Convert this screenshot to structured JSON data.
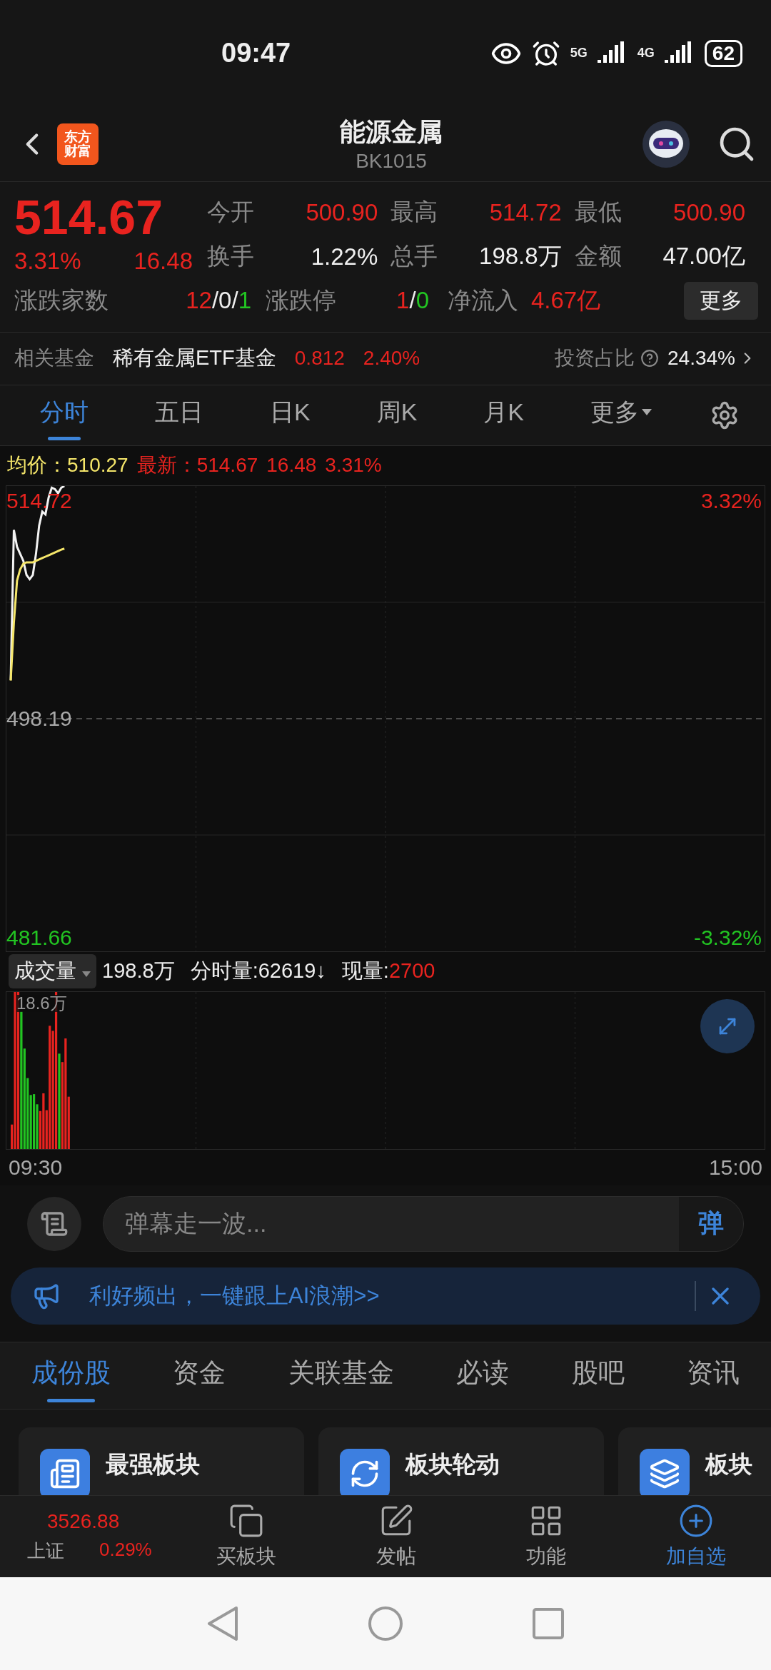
{
  "status_bar": {
    "time": "09:47",
    "net1": "5G",
    "net2": "4G",
    "battery": "62"
  },
  "header": {
    "logo_lines": [
      "东方",
      "财富"
    ],
    "title": "能源金属",
    "code": "BK1015"
  },
  "quote": {
    "price": "514.67",
    "change_pct": "3.31%",
    "change": "16.48",
    "stats": [
      {
        "label": "今开",
        "value": "500.90",
        "color": "#e8231f"
      },
      {
        "label": "最高",
        "value": "514.72",
        "color": "#e8231f"
      },
      {
        "label": "最低",
        "value": "500.90",
        "color": "#e8231f"
      },
      {
        "label": "换手",
        "value": "1.22%",
        "color": "#f0f0f0"
      },
      {
        "label": "总手",
        "value": "198.8万",
        "color": "#f0f0f0"
      },
      {
        "label": "金额",
        "value": "47.00亿",
        "color": "#f0f0f0"
      }
    ],
    "breadth": {
      "label": "涨跌家数",
      "up": "12",
      "sep1": "/",
      "flat": "0",
      "sep2": "/",
      "down": "1"
    },
    "limit": {
      "label": "涨跌停",
      "up": "1",
      "sep": "/",
      "down": "0"
    },
    "inflow": {
      "label": "净流入",
      "value": "4.67亿"
    },
    "more_button": "更多"
  },
  "fund": {
    "label": "相关基金",
    "name": "稀有金属ETF基金",
    "price": "0.812",
    "pct": "2.40%",
    "ratio_label": "投资占比",
    "ratio": "24.34%"
  },
  "chart_tabs": [
    {
      "label": "分时",
      "selected": true
    },
    {
      "label": "五日",
      "selected": false
    },
    {
      "label": "日K",
      "selected": false
    },
    {
      "label": "周K",
      "selected": false
    },
    {
      "label": "月K",
      "selected": false
    },
    {
      "label": "更多",
      "selected": false,
      "kind": "dropdown"
    }
  ],
  "info": {
    "avg_label": "均价：",
    "avg": "510.27",
    "last_label": "最新：",
    "last": "514.67",
    "change": "16.48",
    "pct": "3.31%"
  },
  "price_chart": {
    "kind": "picture",
    "high": "514.72",
    "mid": "498.19",
    "low": "481.66",
    "upper_pct": "3.32%",
    "lower_pct": "-3.32%"
  },
  "volume": {
    "selector": "成交量",
    "total": "198.8万",
    "minute_label": "分时量:",
    "minute": "62619↓",
    "now_label": "现量:",
    "now": "2700",
    "chart": {
      "kind": "picture",
      "scale_label": "18.6万"
    }
  },
  "time_axis": [
    "09:30",
    "15:00"
  ],
  "comment": {
    "placeholder": "弹幕走一波...",
    "send": "弹"
  },
  "banner": {
    "text": "利好频出，一键跟上AI浪潮>>"
  },
  "section_tabs": [
    {
      "label": "成份股",
      "selected": true
    },
    {
      "label": "资金",
      "selected": false
    },
    {
      "label": "关联基金",
      "selected": false
    },
    {
      "label": "必读",
      "selected": false
    },
    {
      "label": "股吧",
      "selected": false
    },
    {
      "label": "资讯",
      "selected": false
    }
  ],
  "cards": [
    {
      "title": "最强板块",
      "kind": "board"
    },
    {
      "title": "板块轮动",
      "kind": "rotate"
    },
    {
      "title": "板块",
      "kind": "layers"
    }
  ],
  "bottom_nav": {
    "index": {
      "value": "3526.88",
      "name": "上证",
      "pct": "0.29%"
    },
    "items": [
      {
        "label": "买板块",
        "kind": "buy",
        "selected": false
      },
      {
        "label": "发帖",
        "kind": "post",
        "selected": false
      },
      {
        "label": "功能",
        "kind": "grid",
        "selected": false
      },
      {
        "label": "加自选",
        "kind": "add",
        "selected": true
      }
    ]
  }
}
